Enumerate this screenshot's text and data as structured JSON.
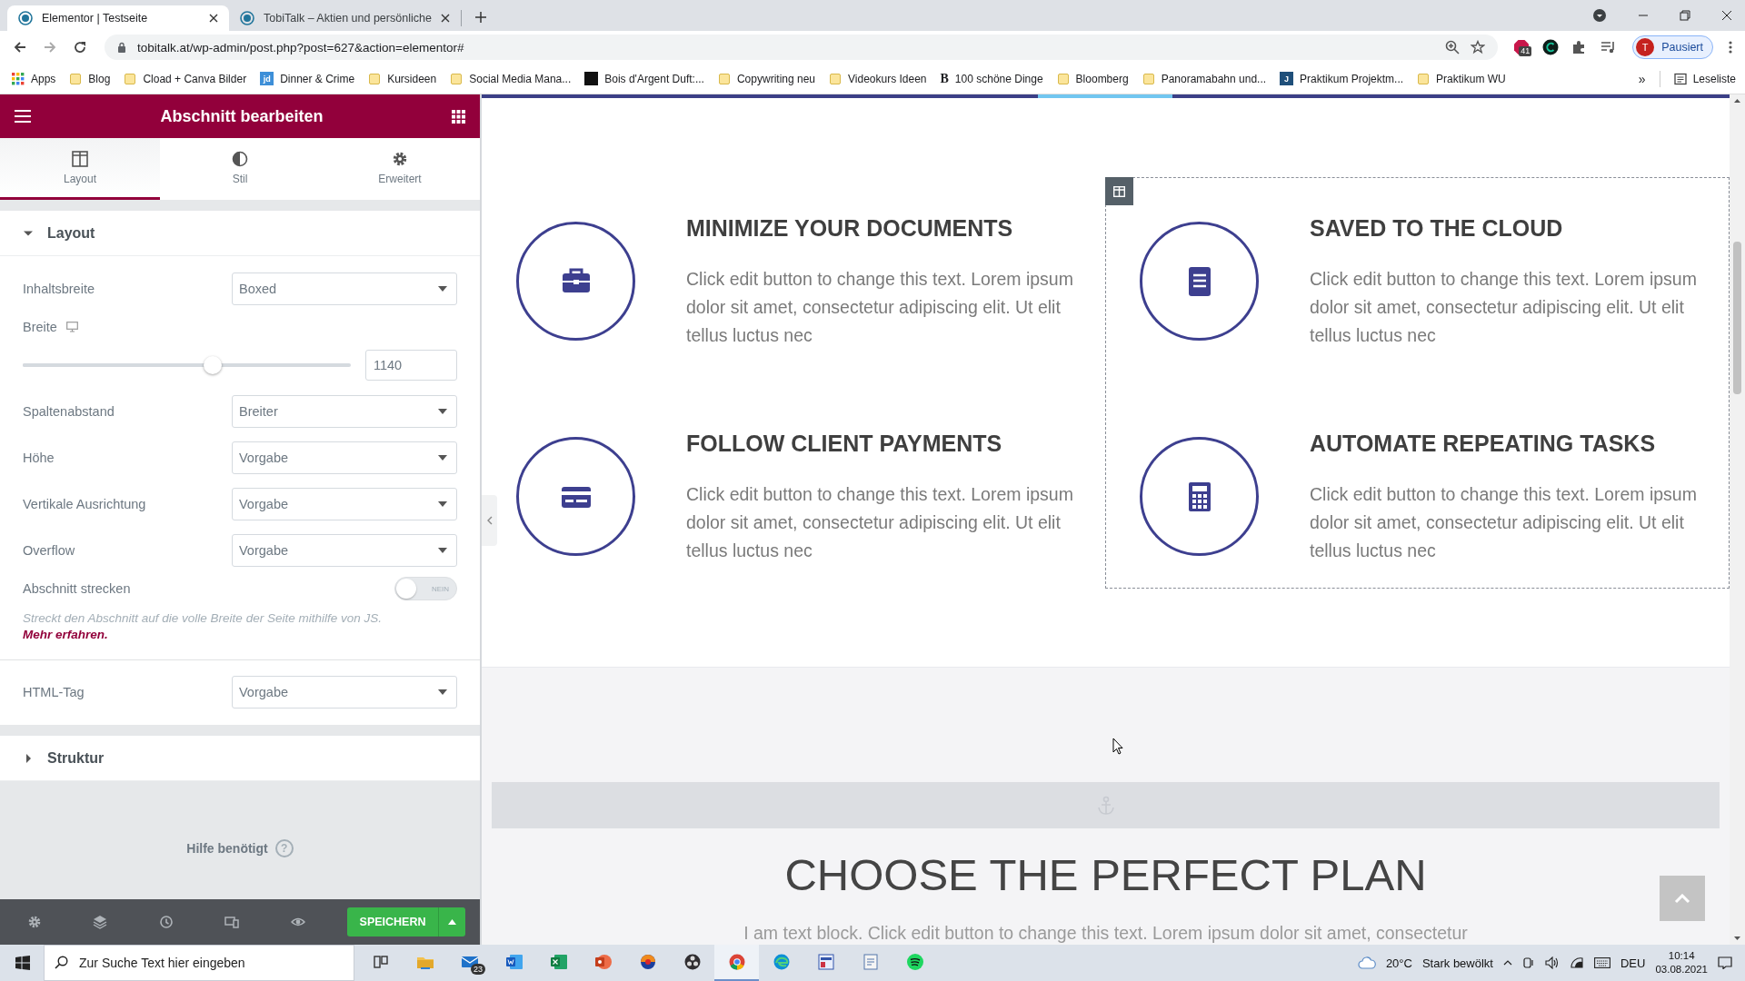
{
  "browser": {
    "tabs": [
      {
        "title": "Elementor | Testseite",
        "selected": true
      },
      {
        "title": "TobiTalk – Aktien und persönliche",
        "selected": false
      }
    ],
    "url": "tobitalk.at/wp-admin/post.php?post=627&action=elementor#",
    "extension_badge": "41",
    "profile": {
      "initial": "T",
      "label": "Pausiert"
    },
    "bookmarks": [
      {
        "label": "Apps",
        "kind": "apps"
      },
      {
        "label": "Blog",
        "kind": "folder"
      },
      {
        "label": "Cload + Canva Bilder",
        "kind": "folder"
      },
      {
        "label": "Dinner & Crime",
        "kind": "tile",
        "glyph": "jd",
        "color": "#3d8fd8"
      },
      {
        "label": "Kursideen",
        "kind": "folder"
      },
      {
        "label": "Social Media Mana...",
        "kind": "folder"
      },
      {
        "label": "Bois d'Argent Duft:...",
        "kind": "tile",
        "color": "#111111"
      },
      {
        "label": "Copywriting neu",
        "kind": "folder"
      },
      {
        "label": "Videokurs Ideen",
        "kind": "folder"
      },
      {
        "label": "100 schöne Dinge",
        "kind": "letter",
        "glyph": "B"
      },
      {
        "label": "Bloomberg",
        "kind": "folder"
      },
      {
        "label": "Panoramabahn und...",
        "kind": "folder"
      },
      {
        "label": "Praktikum Projektm...",
        "kind": "tile",
        "glyph": "J",
        "color": "#1f4f7a"
      },
      {
        "label": "Praktikum WU",
        "kind": "folder"
      }
    ],
    "more": "»",
    "reading_list": "Leseliste"
  },
  "panel": {
    "title": "Abschnitt bearbeiten",
    "tabs": [
      {
        "label": "Layout",
        "kind": "columns",
        "selected": true
      },
      {
        "label": "Stil",
        "kind": "contrast",
        "selected": false
      },
      {
        "label": "Erweitert",
        "kind": "gear",
        "selected": false
      }
    ],
    "sections": [
      {
        "title": "Layout",
        "expanded": true,
        "controls": [
          {
            "kind": "select",
            "label": "Inhaltsbreite",
            "value": "Boxed"
          },
          {
            "kind": "slider",
            "label": "Breite",
            "level": 0.58,
            "value": "1140"
          },
          {
            "kind": "select",
            "label": "Spaltenabstand",
            "value": "Breiter"
          },
          {
            "kind": "select",
            "label": "Höhe",
            "value": "Vorgabe"
          },
          {
            "kind": "select",
            "label": "Vertikale Ausrichtung",
            "value": "Vorgabe"
          },
          {
            "kind": "select",
            "label": "Overflow",
            "value": "Vorgabe"
          },
          {
            "kind": "toggle",
            "label": "Abschnitt strecken",
            "on": false,
            "state_label": "NEIN"
          },
          {
            "kind": "note",
            "text": "Streckt den Abschnitt auf die volle Breite der Seite mithilfe von JS.",
            "link": "Mehr erfahren."
          },
          {
            "kind": "select",
            "label": "HTML-Tag",
            "value": "Vorgabe"
          }
        ]
      },
      {
        "title": "Struktur",
        "expanded": false
      }
    ],
    "help": "Hilfe benötigt",
    "help_mark": "?",
    "save": "SPEICHERN"
  },
  "canvas": {
    "columns": [
      {
        "selected": false,
        "features": [
          {
            "kind": "briefcase",
            "title": "MINIMIZE YOUR DOCUMENTS",
            "text": "Click edit button to change this text. Lorem ipsum dolor sit amet, consectetur adipiscing elit. Ut elit tellus luctus nec"
          },
          {
            "kind": "card",
            "title": "FOLLOW CLIENT PAYMENTS",
            "text": "Click edit button to change this text. Lorem ipsum dolor sit amet, consectetur adipiscing elit. Ut elit tellus luctus nec"
          }
        ]
      },
      {
        "selected": true,
        "features": [
          {
            "kind": "document",
            "title": "SAVED TO THE CLOUD",
            "text": "Click edit button to change this text. Lorem ipsum dolor sit amet, consectetur adipiscing elit. Ut elit tellus luctus nec"
          },
          {
            "kind": "calculator",
            "title": "AUTOMATE REPEATING TASKS",
            "text": "Click edit button to change this text. Lorem ipsum dolor sit amet, consectetur adipiscing elit. Ut elit tellus luctus nec"
          }
        ]
      }
    ],
    "heading": "CHOOSE THE PERFECT PLAN",
    "intro": "I am text block. Click edit button to change this text. Lorem ipsum dolor sit amet, consectetur"
  },
  "taskbar": {
    "search_placeholder": "Zur Suche Text hier eingeben",
    "apps": [
      {
        "kind": "taskview",
        "selected": false
      },
      {
        "kind": "explorer",
        "selected": false
      },
      {
        "kind": "mail",
        "badge": "23",
        "selected": false
      },
      {
        "kind": "word",
        "selected": false
      },
      {
        "kind": "excel",
        "selected": false
      },
      {
        "kind": "powerpoint",
        "selected": false
      },
      {
        "kind": "orb",
        "selected": false
      },
      {
        "kind": "obs",
        "selected": false
      },
      {
        "kind": "chrome",
        "selected": true
      },
      {
        "kind": "edge",
        "selected": false
      },
      {
        "kind": "tool",
        "selected": false
      },
      {
        "kind": "notes",
        "selected": false
      },
      {
        "kind": "spotify",
        "selected": false
      }
    ],
    "temperature": "20°C",
    "weather": "Stark bewölkt",
    "language": "DEU",
    "time": "10:14",
    "date": "03.08.2021"
  }
}
